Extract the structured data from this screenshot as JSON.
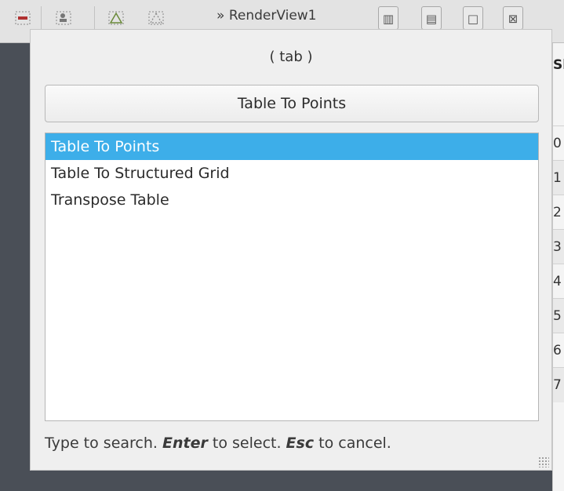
{
  "toolbar": {
    "view_title": "RenderView1",
    "view_arrow": "»",
    "icons": [
      "minus-icon",
      "person-icon",
      "triangle-icon",
      "triangle-outline-icon"
    ],
    "buttons": {
      "split_horizontal": "▥",
      "split_vertical": "▤",
      "maximize": "□",
      "close": "⊠"
    }
  },
  "background_table": {
    "header": "Sl",
    "rows": [
      "0",
      "1",
      "2",
      "3",
      "4",
      "5",
      "6",
      "7"
    ]
  },
  "dialog": {
    "title": "( tab )",
    "selected_action_label": "Table To Points",
    "items": [
      {
        "label": "Table To Points",
        "selected": true
      },
      {
        "label": "Table To Structured Grid",
        "selected": false
      },
      {
        "label": "Transpose Table",
        "selected": false
      }
    ],
    "hint": {
      "part1": "Type to search. ",
      "enter": "Enter",
      "part2": " to select. ",
      "esc": "Esc",
      "part3": " to cancel."
    }
  },
  "colors": {
    "selection": "#3daee9",
    "dark_background": "#4a4f57"
  }
}
